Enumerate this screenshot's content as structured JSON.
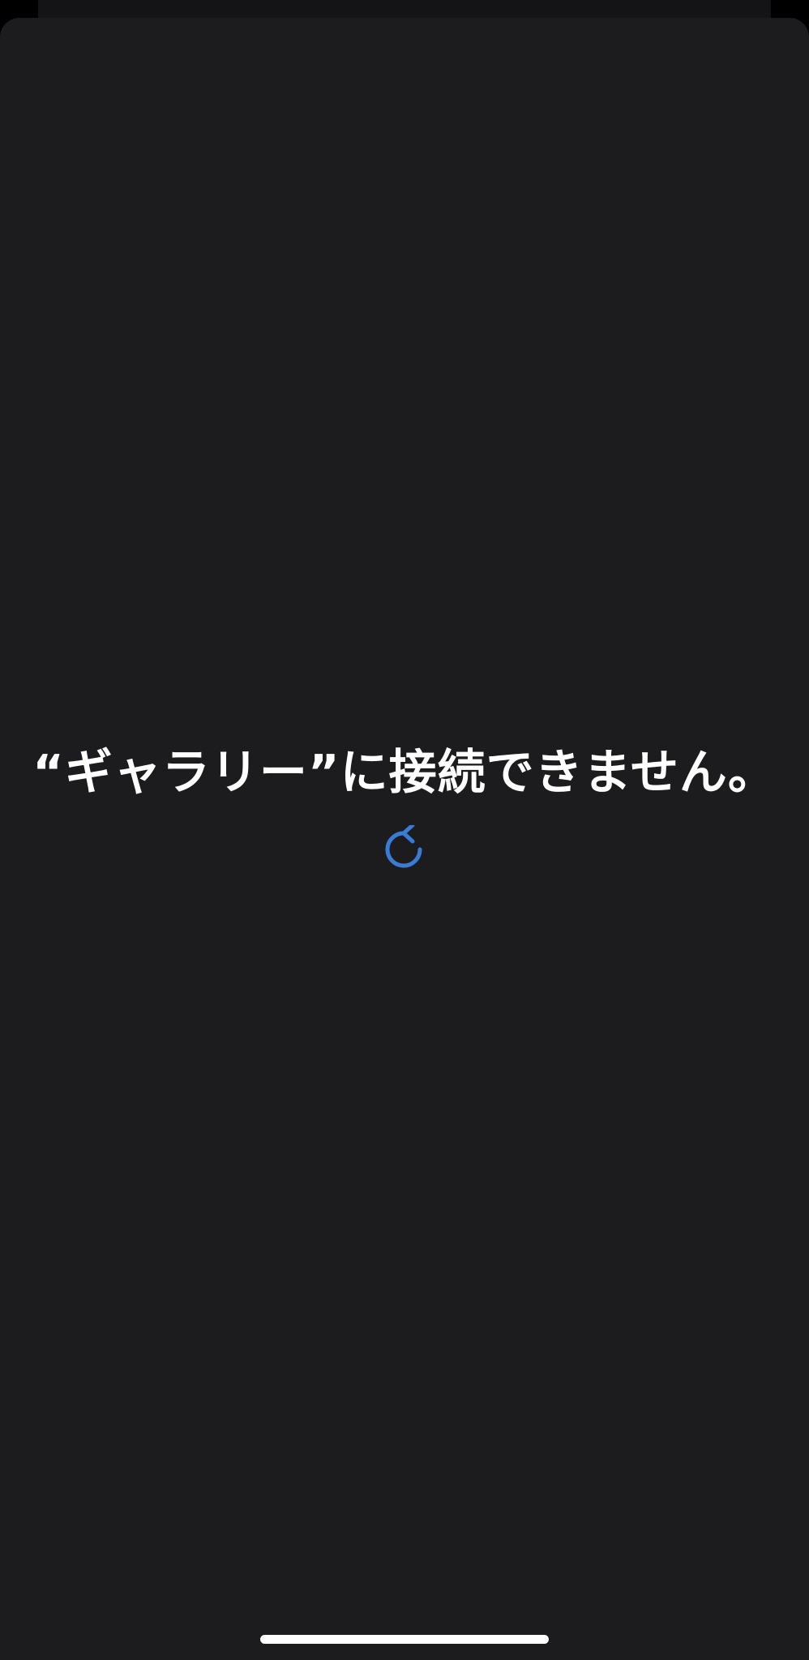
{
  "error": {
    "message": "“ギャラリー”に接続できません。"
  },
  "retry": {
    "icon": "refresh-icon"
  },
  "colors": {
    "background": "#1c1c1e",
    "text": "#ffffff",
    "accent": "#3a7bd5"
  }
}
